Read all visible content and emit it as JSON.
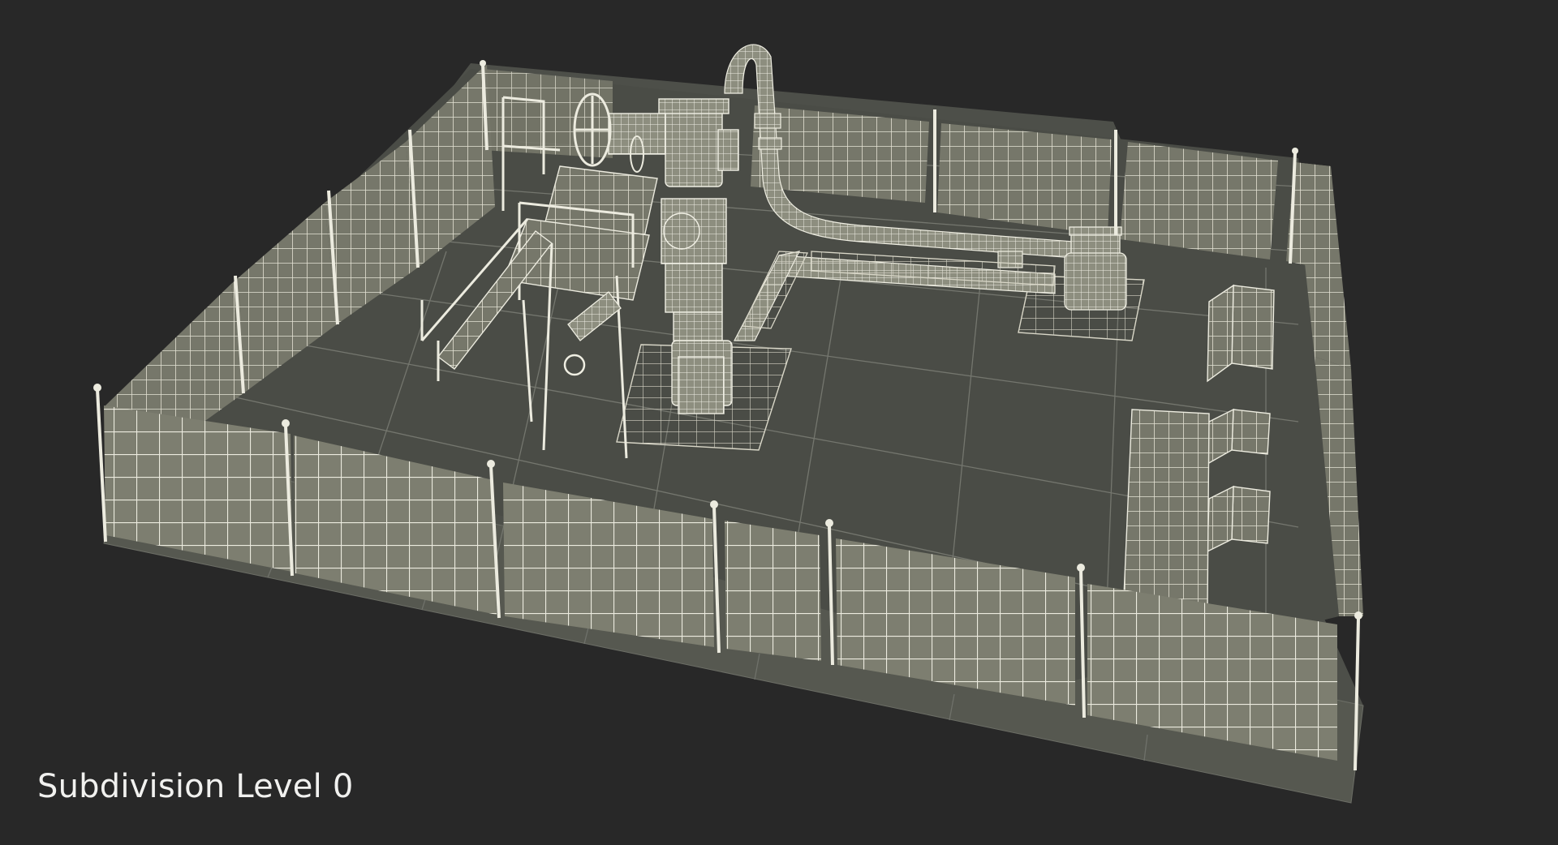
{
  "caption": "Subdivision Level 0",
  "colors": {
    "background": "#282828",
    "floor": "#4b4d47",
    "floor_edge": "#6f716a",
    "wire": "#e6e4d6",
    "model_fill": "#868777",
    "caption_text": "#f1f1ef"
  },
  "scene": {
    "objects": [
      "fence-perimeter",
      "wellhead-christmas-tree",
      "access-platform-with-stairs",
      "handwheel-valve",
      "overhead-pipeline",
      "secondary-wellhead",
      "equipment-cabinets",
      "floor-grating-pads"
    ]
  }
}
